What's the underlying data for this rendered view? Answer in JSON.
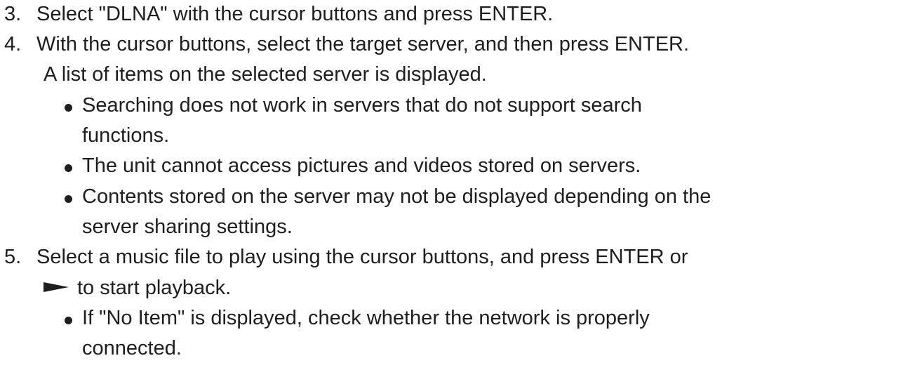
{
  "steps": [
    {
      "number": "3.",
      "lines": [
        "Select \"DLNA\" with the cursor buttons and press ENTER."
      ],
      "bullets": []
    },
    {
      "number": "4.",
      "lines": [
        "With the cursor buttons, select the target server, and then press ENTER.",
        "A list of items on the selected server is displayed."
      ],
      "bullets": [
        [
          "Searching does not work in servers that do not support search",
          "functions."
        ],
        [
          "The unit cannot access pictures and videos stored on servers."
        ],
        [
          "Contents stored on the server may not be displayed depending on the",
          "server sharing settings."
        ]
      ]
    },
    {
      "number": "5.",
      "lines": [
        "Select a music file to play using the cursor buttons, and press ENTER or",
        "to start playback."
      ],
      "play_icon": "play-arrow-icon",
      "bullets": [
        [
          "If \"No Item\" is displayed, check whether the network is properly",
          "connected."
        ]
      ]
    }
  ]
}
